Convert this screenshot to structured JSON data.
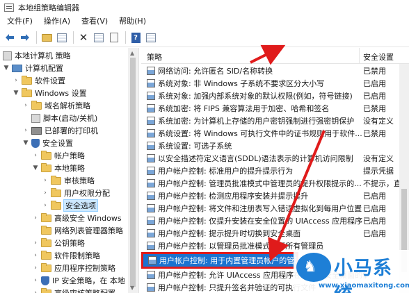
{
  "window": {
    "title": "本地组策略编辑器"
  },
  "menu": {
    "items": [
      "文件(F)",
      "操作(A)",
      "查看(V)",
      "帮助(H)"
    ]
  },
  "toolbar": {
    "icons": [
      "back-arrow-icon",
      "forward-arrow-icon",
      "folder-up-icon",
      "show-hide-tree-icon",
      "delete-icon",
      "properties-icon",
      "export-list-icon",
      "help-icon"
    ],
    "help_glyph": "?"
  },
  "tree": {
    "items": [
      {
        "label": "本地计算机 策略"
      },
      {
        "label": "计算机配置"
      },
      {
        "label": "软件设置"
      },
      {
        "label": "Windows 设置"
      },
      {
        "label": "域名解析策略"
      },
      {
        "label": "脚本(启动/关机)"
      },
      {
        "label": "已部署的打印机"
      },
      {
        "label": "安全设置"
      },
      {
        "label": "帐户策略"
      },
      {
        "label": "本地策略"
      },
      {
        "label": "审核策略"
      },
      {
        "label": "用户权限分配"
      },
      {
        "label": "安全选项"
      },
      {
        "label": "高级安全 Windows"
      },
      {
        "label": "网络列表管理器策略"
      },
      {
        "label": "公钥策略"
      },
      {
        "label": "软件限制策略"
      },
      {
        "label": "应用程序控制策略"
      },
      {
        "label": "IP 安全策略，在 本地"
      },
      {
        "label": "高级审核策略配置"
      }
    ]
  },
  "list": {
    "header": {
      "policy": "策略",
      "setting": "安全设置"
    },
    "rows": [
      {
        "policy": "网络访问: 允许匿名 SID/名称转换",
        "state": "已禁用"
      },
      {
        "policy": "系统对象: 非 Windows 子系统不要求区分大小写",
        "state": "已启用"
      },
      {
        "policy": "系统对象: 加强内部系统对象的默认权限(例如，符号链接)",
        "state": "已启用"
      },
      {
        "policy": "系统加密: 将 FIPS 兼容算法用于加密、哈希和签名",
        "state": "已禁用"
      },
      {
        "policy": "系统加密: 为计算机上存储的用户密钥强制进行强密钥保护",
        "state": "没有定义"
      },
      {
        "policy": "系统设置: 将 Windows 可执行文件中的证书规则用于软件...",
        "state": "已禁用"
      },
      {
        "policy": "系统设置: 可选子系统",
        "state": ""
      },
      {
        "policy": "以安全描述符定义语言(SDDL)语法表示的计算机访问限制",
        "state": "没有定义"
      },
      {
        "policy": "用户帐户控制: 标准用户的提升提示行为",
        "state": "提示凭据"
      },
      {
        "policy": "用户帐户控制: 管理员批准模式中管理员的提升权限提示的...",
        "state": "不提示，直"
      },
      {
        "policy": "用户帐户控制: 检测应用程序安装并提示提升",
        "state": "已启用"
      },
      {
        "policy": "用户帐户控制: 将文件和注册表写入错误虚拟化到每用户位置",
        "state": "已启用"
      },
      {
        "policy": "用户帐户控制: 仅提升安装在安全位置的 UIAccess 应用程序",
        "state": "已启用"
      },
      {
        "policy": "用户帐户控制: 提示提升时切换到安全桌面",
        "state": "已启用"
      },
      {
        "policy": "用户帐户控制: 以管理员批准模式运行所有管理员",
        "state": ""
      },
      {
        "policy": "用户帐户控制: 用于内置管理员帐户的管理员批准模式",
        "state": ""
      },
      {
        "policy": "用户帐户控制: 允许 UIAccess 应用程序在不使用安全桌面的情况下提升",
        "state": ""
      },
      {
        "policy": "用户帐户控制: 只提升签名并验证的可执行文件",
        "state": ""
      }
    ]
  },
  "watermark": {
    "name": "小马系统",
    "url": "www.xiaomaxitong.com",
    "color": "#1e7fd6"
  },
  "annotation": {
    "arrow_color": "#e01b1b",
    "highlight_color": "#1a73d0"
  }
}
